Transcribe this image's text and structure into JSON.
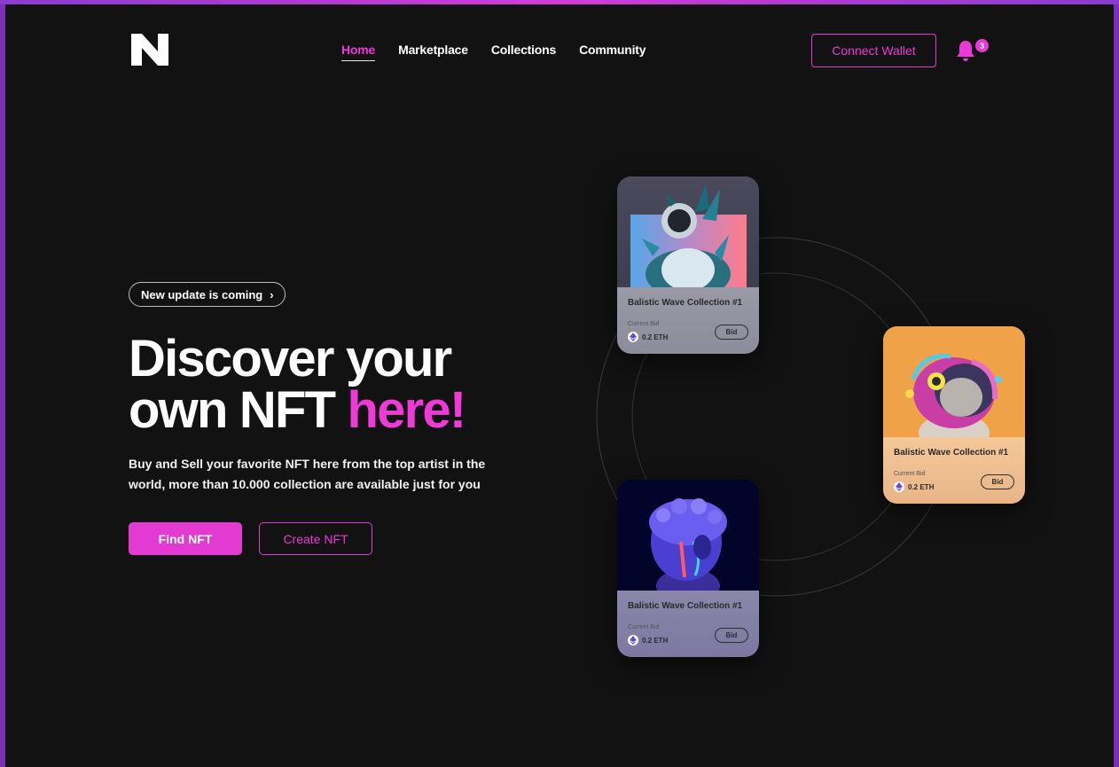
{
  "brand": {
    "logo": "N"
  },
  "nav": {
    "items": [
      {
        "label": "Home",
        "active": true
      },
      {
        "label": "Marketplace",
        "active": false
      },
      {
        "label": "Collections",
        "active": false
      },
      {
        "label": "Community",
        "active": false
      }
    ]
  },
  "header": {
    "connect_wallet": "Connect Wallet",
    "notification_count": "3"
  },
  "hero": {
    "pill_label": "New update is coming",
    "title_line1": "Discover your",
    "title_line2_plain": "own NFT ",
    "title_line2_accent": "here!",
    "subtitle": "Buy and Sell your favorite NFT here from the top artist in the world, more than 10.000 collection are available just for you",
    "find_button": "Find NFT",
    "create_button": "Create NFT"
  },
  "cards": [
    {
      "title": "Balistic Wave Collection #1",
      "bid_label": "Current Bid",
      "price": "0.2 ETH",
      "bid_button": "Bid",
      "image": "astronaut-crystal"
    },
    {
      "title": "Balistic Wave Collection #1",
      "bid_label": "Current Bid",
      "price": "0.2 ETH",
      "bid_button": "Bid",
      "image": "psychedelic-ape"
    },
    {
      "title": "Balistic Wave Collection #1",
      "bid_label": "Current Bid",
      "price": "0.2 ETH",
      "bid_button": "Bid",
      "image": "neon-statue-head"
    }
  ],
  "colors": {
    "accent": "#e93ad7",
    "background": "#121212"
  }
}
